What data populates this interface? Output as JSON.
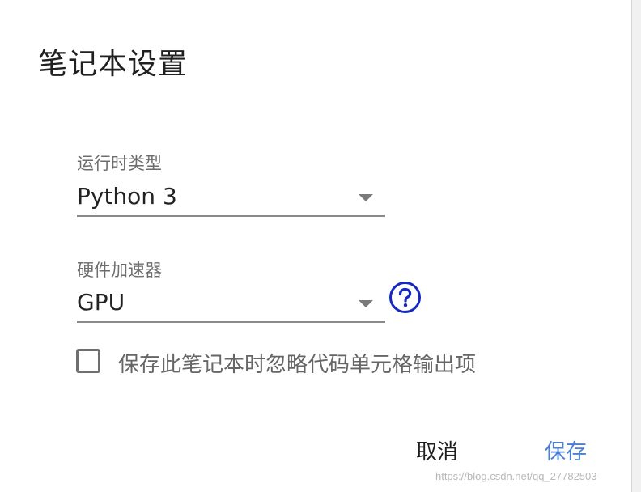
{
  "dialog": {
    "title": "笔记本设置",
    "runtime": {
      "label": "运行时类型",
      "value": "Python 3"
    },
    "accelerator": {
      "label": "硬件加速器",
      "value": "GPU",
      "help_icon": "question-circle-icon"
    },
    "omit_output": {
      "label": "保存此笔记本时忽略代码单元格输出项",
      "checked": false
    },
    "buttons": {
      "cancel": "取消",
      "save": "保存"
    }
  },
  "watermark": "https://blog.csdn.net/qq_27782503",
  "colors": {
    "accent": "#4a7fd6",
    "help_icon": "#1428c8"
  }
}
